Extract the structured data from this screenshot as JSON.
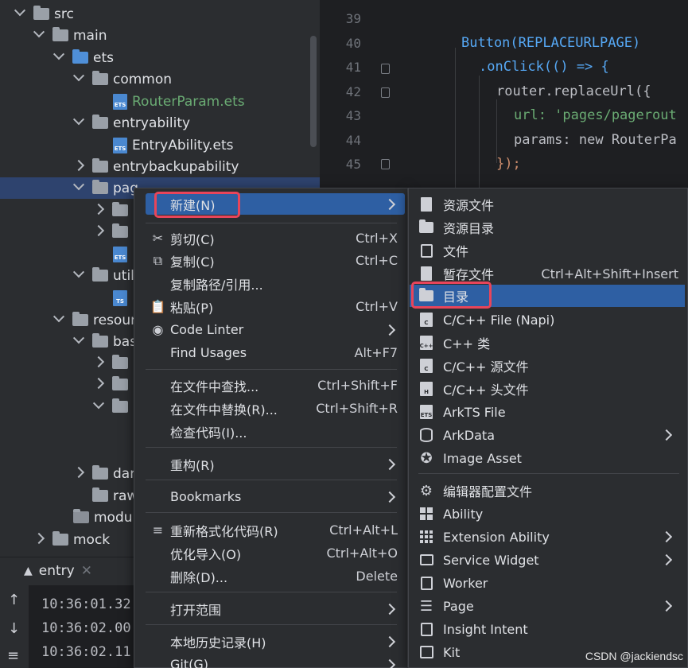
{
  "tree": {
    "items": [
      {
        "label": "src",
        "state": "open",
        "icon": "folder"
      },
      {
        "label": "main",
        "state": "open",
        "icon": "folder"
      },
      {
        "label": "ets",
        "state": "open",
        "icon": "folder-blue"
      },
      {
        "label": "common",
        "state": "open",
        "icon": "folder"
      },
      {
        "label": "RouterParam.ets",
        "state": "file",
        "icon": "ets-file"
      },
      {
        "label": "entryability",
        "state": "open",
        "icon": "folder"
      },
      {
        "label": "EntryAbility.ets",
        "state": "file",
        "icon": "ets-file"
      },
      {
        "label": "entrybackupability",
        "state": "closed",
        "icon": "folder"
      },
      {
        "label": "pag",
        "state": "open",
        "icon": "folder"
      },
      {
        "label": "util",
        "state": "open",
        "icon": "folder"
      },
      {
        "label": "resour",
        "state": "open",
        "icon": "folder"
      },
      {
        "label": "bas",
        "state": "open",
        "icon": "folder"
      },
      {
        "label": "dar",
        "state": "closed",
        "icon": "folder"
      },
      {
        "label": "raw",
        "state": "none",
        "icon": "folder"
      },
      {
        "label": "modul",
        "state": "none",
        "icon": "module-file"
      },
      {
        "label": "mock",
        "state": "closed",
        "icon": "folder"
      }
    ]
  },
  "editor": {
    "lines": [
      {
        "num": "39",
        "code": ""
      },
      {
        "num": "40",
        "code": "Button(REPLACEURLPAGE)"
      },
      {
        "num": "41",
        "code": ".onClick(() => {"
      },
      {
        "num": "42",
        "code": "router.replaceUrl({"
      },
      {
        "num": "43",
        "code": "url: 'pages/pagerout"
      },
      {
        "num": "44",
        "code": "params: new RouterPa"
      },
      {
        "num": "45",
        "code": "});"
      }
    ]
  },
  "run": {
    "tab_label": "entry",
    "logs": [
      "10:36:01.32",
      "10:36:02.00",
      "10:36:02.11"
    ]
  },
  "context_menu": {
    "new": "新建(N)",
    "cut": "剪切(C)",
    "cut_sc": "Ctrl+X",
    "copy": "复制(C)",
    "copy_sc": "Ctrl+C",
    "copy_path": "复制路径/引用...",
    "paste": "粘贴(P)",
    "paste_sc": "Ctrl+V",
    "code_linter": "Code Linter",
    "find_usages": "Find Usages",
    "find_usages_sc": "Alt+F7",
    "find_in_files": "在文件中查找...",
    "find_in_files_sc": "Ctrl+Shift+F",
    "replace_in_files": "在文件中替换(R)...",
    "replace_in_files_sc": "Ctrl+Shift+R",
    "inspect": "检查代码(I)...",
    "refactor": "重构(R)",
    "bookmarks": "Bookmarks",
    "reformat": "重新格式化代码(R)",
    "reformat_sc": "Ctrl+Alt+L",
    "optimize": "优化导入(O)",
    "optimize_sc": "Ctrl+Alt+O",
    "delete": "删除(D)...",
    "delete_sc": "Delete",
    "open_in": "打开范围",
    "local_history": "本地历史记录(H)",
    "git": "Git(G)"
  },
  "submenu": {
    "resource_file": "资源文件",
    "resource_dir": "资源目录",
    "file": "文件",
    "scratch": "暂存文件",
    "scratch_sc": "Ctrl+Alt+Shift+Insert",
    "directory": "目录",
    "cpp_napi": "C/C++ File (Napi)",
    "cpp_class": "C++ 类",
    "cpp_source": "C/C++ 源文件",
    "cpp_header": "C/C++ 头文件",
    "arkts_file": "ArkTS File",
    "arkdata": "ArkData",
    "image_asset": "Image Asset",
    "editor_config": "编辑器配置文件",
    "ability": "Ability",
    "extension_ability": "Extension Ability",
    "service_widget": "Service Widget",
    "worker": "Worker",
    "page": "Page",
    "insight_intent": "Insight Intent",
    "kit": "Kit"
  },
  "watermark": "CSDN @jackiendsc"
}
